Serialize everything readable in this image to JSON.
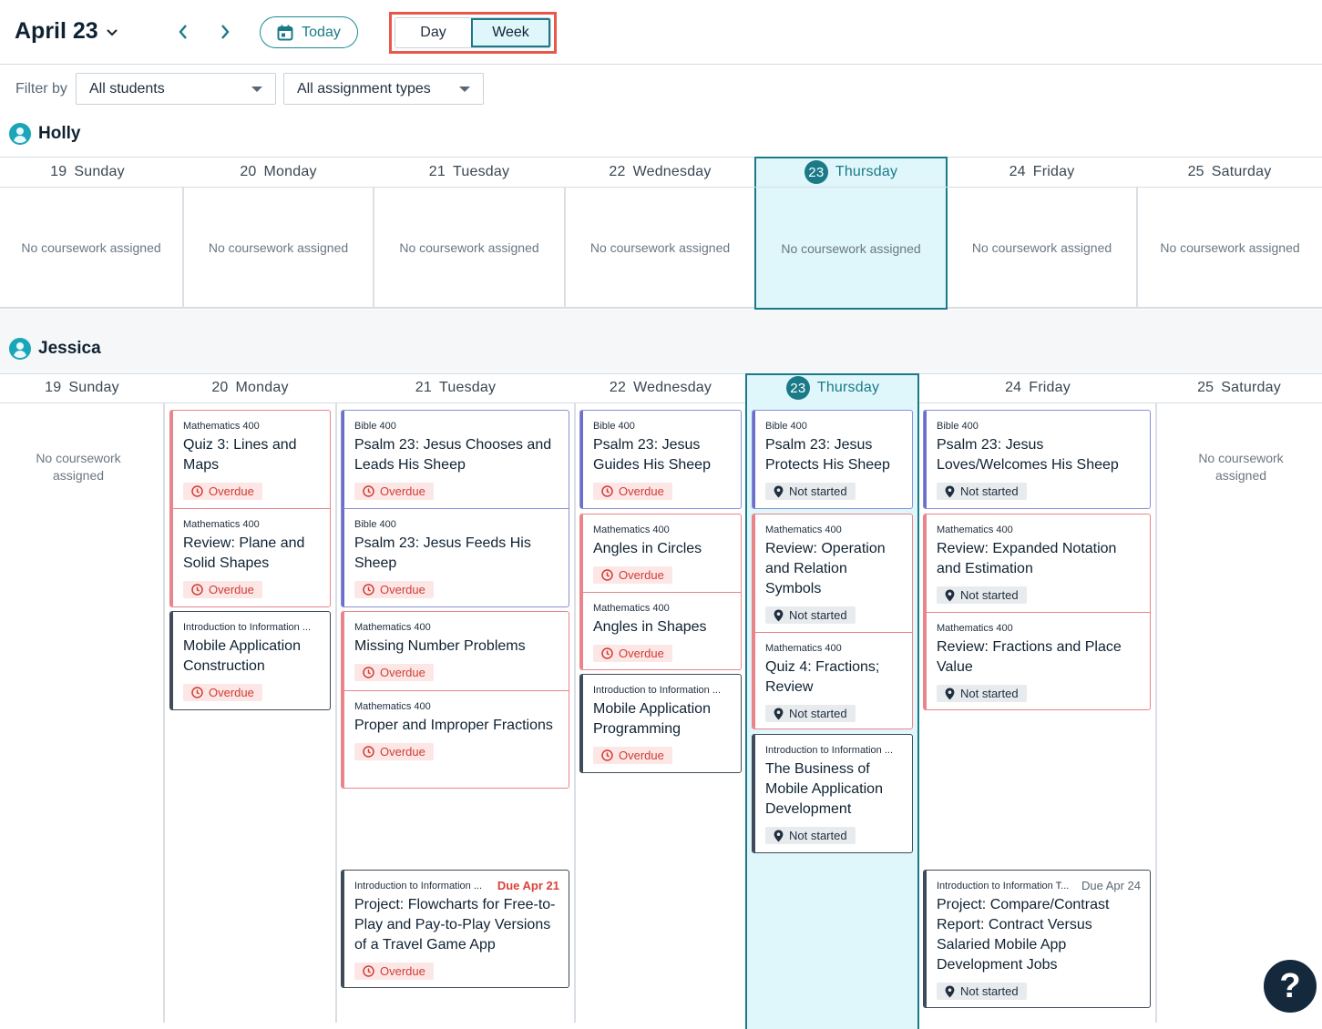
{
  "header": {
    "date_label": "April 23",
    "today_label": "Today",
    "view_day": "Day",
    "view_week": "Week"
  },
  "filters": {
    "label": "Filter by",
    "students": "All students",
    "types": "All assignment types"
  },
  "days": [
    {
      "num": "19",
      "name": "Sunday"
    },
    {
      "num": "20",
      "name": "Monday"
    },
    {
      "num": "21",
      "name": "Tuesday"
    },
    {
      "num": "22",
      "name": "Wednesday"
    },
    {
      "num": "23",
      "name": "Thursday"
    },
    {
      "num": "24",
      "name": "Friday"
    },
    {
      "num": "25",
      "name": "Saturday"
    }
  ],
  "empty_text": "No coursework assigned",
  "status": {
    "overdue": "Overdue",
    "not_started": "Not started"
  },
  "students": [
    {
      "name": "Holly"
    },
    {
      "name": "Jessica"
    }
  ],
  "jessica": {
    "mon": [
      {
        "subject": "Mathematics 400",
        "title": "Quiz 3: Lines and Maps"
      },
      {
        "subject": "Mathematics 400",
        "title": "Review: Plane and Solid Shapes"
      },
      {
        "subject": "Introduction to Information ...",
        "title": "Mobile Application Construction"
      }
    ],
    "tue": [
      {
        "subject": "Bible 400",
        "title": "Psalm 23: Jesus Chooses and Leads His Sheep"
      },
      {
        "subject": "Bible 400",
        "title": "Psalm 23: Jesus Feeds His Sheep"
      },
      {
        "subject": "Mathematics 400",
        "title": "Missing Number Problems"
      },
      {
        "subject": "Mathematics 400",
        "title": "Proper and Improper Fractions"
      },
      {
        "subject": "Introduction to Information ...",
        "title": "Project: Flowcharts for Free-to-Play and Pay-to-Play Versions of a Travel Game App",
        "due": "Due Apr 21"
      }
    ],
    "wed": [
      {
        "subject": "Bible 400",
        "title": "Psalm 23: Jesus Guides His Sheep"
      },
      {
        "subject": "Mathematics 400",
        "title": "Angles in Circles"
      },
      {
        "subject": "Mathematics 400",
        "title": "Angles in Shapes"
      },
      {
        "subject": "Introduction to Information ...",
        "title": "Mobile Application Programming"
      }
    ],
    "thu": [
      {
        "subject": "Bible 400",
        "title": "Psalm 23: Jesus Protects His Sheep"
      },
      {
        "subject": "Mathematics 400",
        "title": "Review: Operation and Relation Symbols"
      },
      {
        "subject": "Mathematics 400",
        "title": "Quiz 4: Fractions; Review"
      },
      {
        "subject": "Introduction to Information ...",
        "title": "The Business of Mobile Application Development"
      }
    ],
    "fri": [
      {
        "subject": "Bible 400",
        "title": "Psalm 23: Jesus Loves/Welcomes His Sheep"
      },
      {
        "subject": "Mathematics 400",
        "title": "Review: Expanded Notation and Estimation"
      },
      {
        "subject": "Mathematics 400",
        "title": "Review: Fractions and Place Value"
      },
      {
        "subject": "Introduction to Information T...",
        "title": "Project: Compare/Contrast Report: Contract Versus Salaried Mobile App Development Jobs",
        "due": "Due Apr 24"
      }
    ]
  },
  "help_label": "?"
}
